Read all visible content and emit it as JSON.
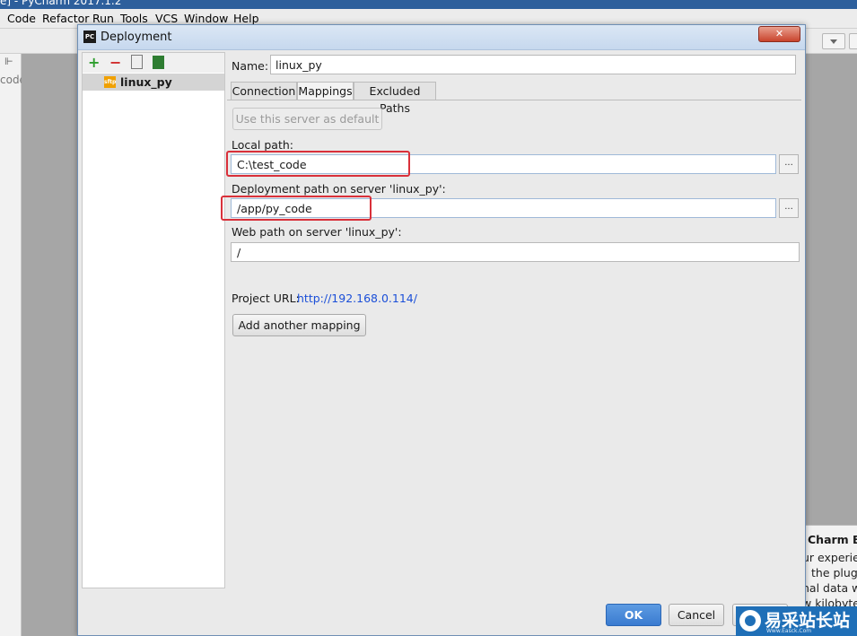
{
  "ide": {
    "title": "e] - PyCharm 2017.1.2",
    "menu": [
      "Code",
      "Refactor",
      "Run",
      "Tools",
      "VCS",
      "Window",
      "Help"
    ],
    "tree_fragment": "code"
  },
  "dialog": {
    "title": "Deployment",
    "close": "✕",
    "servers": [
      {
        "label": "linux_py"
      }
    ],
    "name_label": "Name:",
    "name_value": "linux_py",
    "tabs": [
      {
        "label": "Connection",
        "active": false
      },
      {
        "label": "Mappings",
        "active": true
      },
      {
        "label": "Excluded Paths",
        "active": false
      }
    ],
    "default_button": "Use this server as default",
    "local_path_label": "Local path:",
    "local_path_value": "C:\\test_code",
    "deploy_path_label": "Deployment path on server 'linux_py':",
    "deploy_path_value": "/app/py_code",
    "web_path_label": "Web path on server 'linux_py':",
    "web_path_value": "/",
    "project_url_label": "Project URL:",
    "project_url_value": "http://192.168.0.114/",
    "add_mapping_button": "Add another mapping",
    "browse": "...",
    "ok": "OK",
    "cancel": "Cancel"
  },
  "notification": {
    "title": "Charm Bo",
    "lines": [
      "ur experie",
      "the plugi",
      "nal data w",
      "w kilobyte"
    ]
  },
  "watermark": {
    "text": "易采站长站",
    "sub": "Www.Easck.Com"
  },
  "colors": {
    "highlight": "#d9303a",
    "ok_button": "#3a7bd0",
    "link": "#1b4fd8",
    "add_icon": "#2e9e2e",
    "remove_icon": "#d02a2a"
  }
}
